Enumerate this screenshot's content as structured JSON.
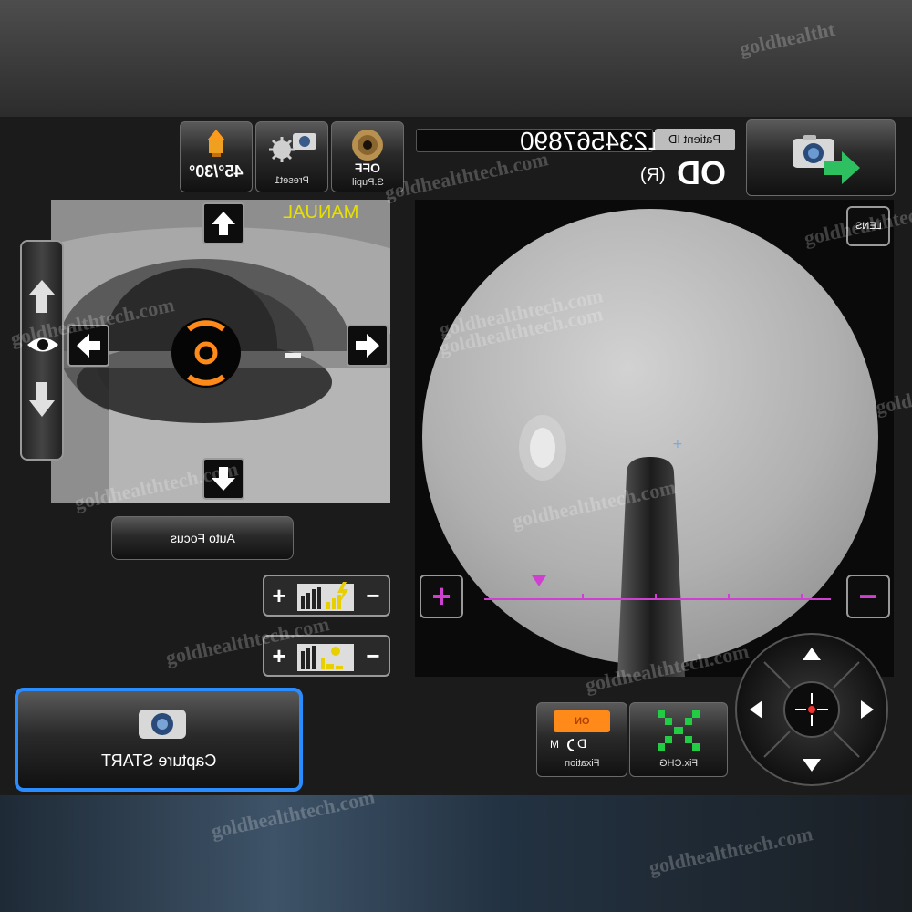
{
  "header": {
    "mode_angle": "45°/30°",
    "preset_label": "Preset1",
    "pupil_value": "OFF",
    "pupil_label": "S.Pupil",
    "patient_id_label": "Patient ID",
    "patient_id_value": "1234567890",
    "eye_main": "OD",
    "eye_side": "(R)"
  },
  "anterior": {
    "mode_text": "MANUAL",
    "autofocus_label": "Auto Focus"
  },
  "fundus": {
    "lens_label": "LENS"
  },
  "controls": {
    "plus_symbol": "+",
    "minus_symbol": "−",
    "fixation_tag": "ON",
    "fixation_dir": "D",
    "fixation_m": "M",
    "fixation_label": "Fixation",
    "fixchg_label": "Fix.CHG",
    "capture_label": "Capture START"
  },
  "watermarks": [
    "goldhealtht",
    "goldhealthtech.com",
    "goldhealthtech.com",
    "goldhealthtech.com",
    "goldhealthtech.com",
    "goldhealthtech.com",
    "goldhealthtech.com",
    "goldhealthtech.com",
    "goldhealthtech.com",
    "goldhealthtech.com",
    "goldhealthtech.com",
    "gold",
    "goldhealthtech.com"
  ],
  "colors": {
    "accent_orange": "#ff8a1a",
    "manual_yellow": "#e8e000",
    "magenta": "#d040d0",
    "fix_green": "#22cc44",
    "capture_border": "#2a8cff"
  },
  "icons": {
    "mode": "led-angle-icon",
    "preset": "gear-camera-icon",
    "pupil": "pupil-icon",
    "capture": "camera-icon",
    "export": "camera-arrow-icon"
  }
}
